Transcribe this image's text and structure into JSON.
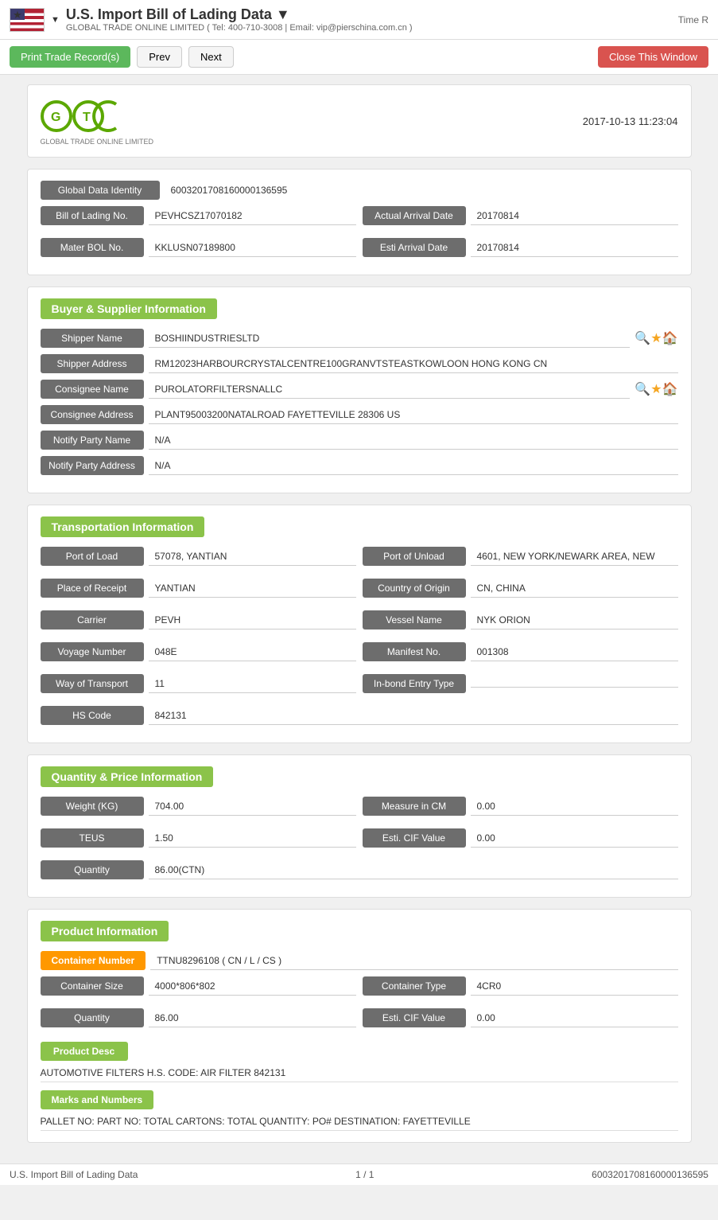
{
  "header": {
    "title": "U.S. Import Bill of Lading Data ▼",
    "company": "GLOBAL TRADE ONLINE LIMITED ( Tel: 400-710-3008 | Email: vip@pierschina.com.cn )",
    "time_label": "Time R"
  },
  "toolbar": {
    "print_label": "Print Trade Record(s)",
    "prev_label": "Prev",
    "next_label": "Next",
    "close_label": "Close This Window"
  },
  "logo": {
    "name": "GTC",
    "full_name": "GLOBAL TRADE ONLINE LIMITED",
    "timestamp": "2017-10-13 11:23:04"
  },
  "global_data": {
    "identity_label": "Global Data Identity",
    "identity_value": "6003201708160000136595",
    "bol_label": "Bill of Lading No.",
    "bol_value": "PEVHCSZ17070182",
    "arrival_actual_label": "Actual Arrival Date",
    "arrival_actual_value": "20170814",
    "master_bol_label": "Mater BOL No.",
    "master_bol_value": "KKLUSN07189800",
    "arrival_esti_label": "Esti Arrival Date",
    "arrival_esti_value": "20170814"
  },
  "buyer_supplier": {
    "section_title": "Buyer & Supplier Information",
    "shipper_name_label": "Shipper Name",
    "shipper_name_value": "BOSHIINDUSTRIESLTD",
    "shipper_address_label": "Shipper Address",
    "shipper_address_value": "RM12023HARBOURCRYSTALCENTRE100GRANVTSTEASTKOWLOON HONG KONG CN",
    "consignee_name_label": "Consignee Name",
    "consignee_name_value": "PUROLATORFILTERSNALLC",
    "consignee_address_label": "Consignee Address",
    "consignee_address_value": "PLANT95003200NATALROAD FAYETTEVILLE 28306 US",
    "notify_party_name_label": "Notify Party Name",
    "notify_party_name_value": "N/A",
    "notify_party_address_label": "Notify Party Address",
    "notify_party_address_value": "N/A"
  },
  "transportation": {
    "section_title": "Transportation Information",
    "port_load_label": "Port of Load",
    "port_load_value": "57078, YANTIAN",
    "port_unload_label": "Port of Unload",
    "port_unload_value": "4601, NEW YORK/NEWARK AREA, NEW",
    "place_receipt_label": "Place of Receipt",
    "place_receipt_value": "YANTIAN",
    "country_origin_label": "Country of Origin",
    "country_origin_value": "CN, CHINA",
    "carrier_label": "Carrier",
    "carrier_value": "PEVH",
    "vessel_name_label": "Vessel Name",
    "vessel_name_value": "NYK ORION",
    "voyage_label": "Voyage Number",
    "voyage_value": "048E",
    "manifest_label": "Manifest No.",
    "manifest_value": "001308",
    "way_transport_label": "Way of Transport",
    "way_transport_value": "11",
    "inbond_label": "In-bond Entry Type",
    "inbond_value": "",
    "hs_code_label": "HS Code",
    "hs_code_value": "842131"
  },
  "quantity_price": {
    "section_title": "Quantity & Price Information",
    "weight_label": "Weight (KG)",
    "weight_value": "704.00",
    "measure_label": "Measure in CM",
    "measure_value": "0.00",
    "teus_label": "TEUS",
    "teus_value": "1.50",
    "esti_cif_label": "Esti. CIF Value",
    "esti_cif_value": "0.00",
    "quantity_label": "Quantity",
    "quantity_value": "86.00(CTN)"
  },
  "product_information": {
    "section_title": "Product Information",
    "container_number_label": "Container Number",
    "container_number_value": "TTNU8296108 ( CN / L / CS )",
    "container_size_label": "Container Size",
    "container_size_value": "4000*806*802",
    "container_type_label": "Container Type",
    "container_type_value": "4CR0",
    "quantity_label": "Quantity",
    "quantity_value": "86.00",
    "esti_cif_label": "Esti. CIF Value",
    "esti_cif_value": "0.00",
    "product_desc_label": "Product Desc",
    "product_desc_text": "AUTOMOTIVE FILTERS H.S. CODE: AIR FILTER 842131",
    "marks_label": "Marks and Numbers",
    "marks_text": "PALLET NO: PART NO: TOTAL CARTONS: TOTAL QUANTITY: PO# DESTINATION: FAYETTEVILLE"
  },
  "footer": {
    "left": "U.S. Import Bill of Lading Data",
    "center": "1 / 1",
    "right": "6003201708160000136595"
  }
}
